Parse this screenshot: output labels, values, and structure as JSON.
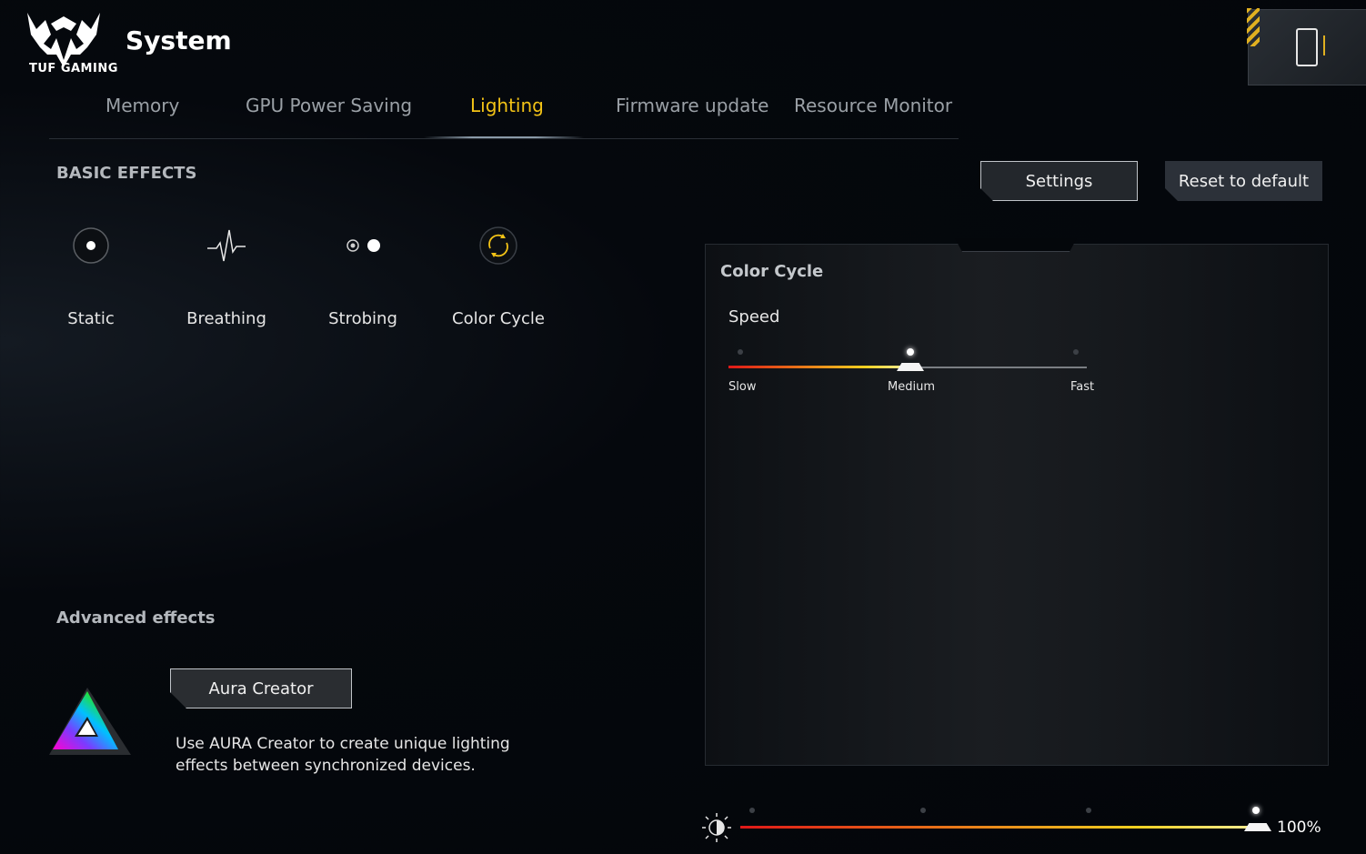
{
  "header": {
    "logo_text": "TUF GAMING",
    "title": "System",
    "device_icon": "phone-device-icon"
  },
  "tabs": [
    {
      "label": "Memory",
      "active": false
    },
    {
      "label": "GPU Power Saving",
      "active": false
    },
    {
      "label": "Lighting",
      "active": true
    },
    {
      "label": "Firmware update",
      "active": false
    },
    {
      "label": "Resource Monitor",
      "active": false
    }
  ],
  "basic_effects": {
    "title": "BASIC EFFECTS",
    "items": [
      {
        "label": "Static",
        "icon": "static-dot-icon"
      },
      {
        "label": "Breathing",
        "icon": "breathing-wave-icon"
      },
      {
        "label": "Strobing",
        "icon": "strobing-dots-icon"
      },
      {
        "label": "Color Cycle",
        "icon": "color-cycle-icon"
      }
    ]
  },
  "buttons": {
    "settings": "Settings",
    "reset": "Reset to default"
  },
  "panel": {
    "title": "Color Cycle",
    "speed_label": "Speed",
    "speed_options": [
      "Slow",
      "Medium",
      "Fast"
    ],
    "speed_selected": "Medium"
  },
  "advanced": {
    "title": "Advanced effects",
    "aura_button": "Aura Creator",
    "description": "Use AURA Creator to create unique lighting effects between synchronized devices."
  },
  "brightness": {
    "value_label": "100%",
    "level_fraction": 1.0,
    "steps": 4
  },
  "colors": {
    "accent": "#f3c316",
    "background": "#04070b",
    "slider_start": "#e01818",
    "slider_end": "#f6f0a0"
  }
}
